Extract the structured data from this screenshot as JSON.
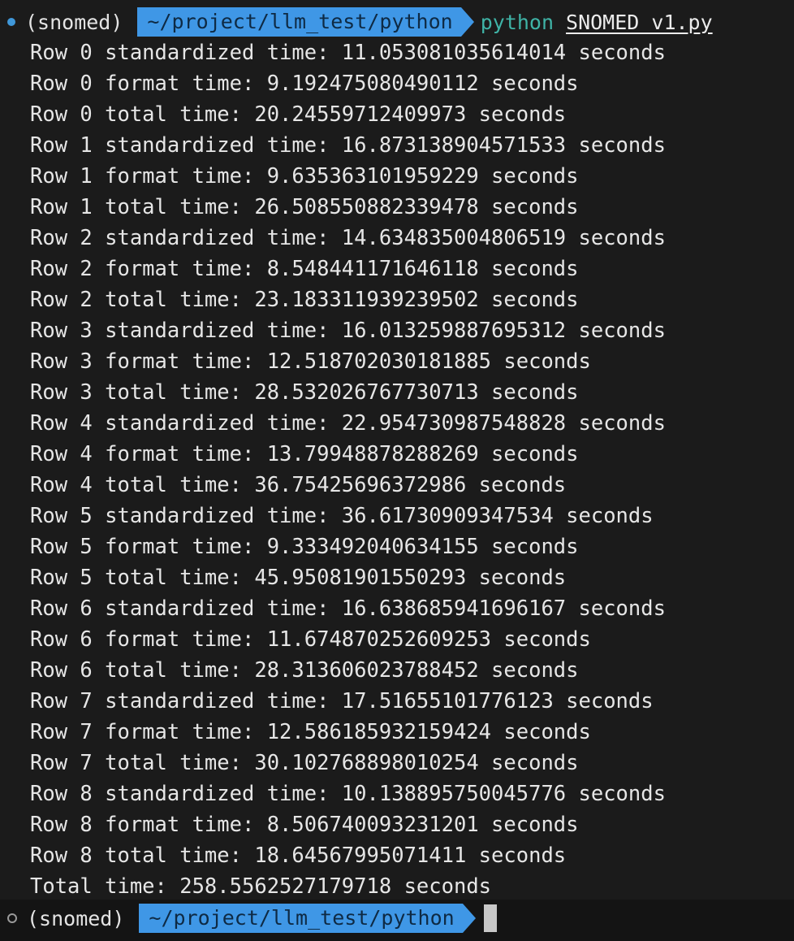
{
  "colors": {
    "background": "#1b1b1b",
    "path_segment": "#3f97e6",
    "command_green": "#3fb3a6",
    "status_dot_active": "#3f97d9"
  },
  "prompt_top": {
    "status_icon": "filled-circle-icon",
    "env": "(snomed)",
    "path": "~/project/llm_test/python",
    "command": "python",
    "script": "SNOMED_v1.py"
  },
  "output": [
    "Row 0 standardized time: 11.053081035614014 seconds",
    "Row 0 format time: 9.192475080490112 seconds",
    "Row 0 total time: 20.24559712409973 seconds",
    "Row 1 standardized time: 16.873138904571533 seconds",
    "Row 1 format time: 9.635363101959229 seconds",
    "Row 1 total time: 26.508550882339478 seconds",
    "Row 2 standardized time: 14.634835004806519 seconds",
    "Row 2 format time: 8.548441171646118 seconds",
    "Row 2 total time: 23.183311939239502 seconds",
    "Row 3 standardized time: 16.013259887695312 seconds",
    "Row 3 format time: 12.518702030181885 seconds",
    "Row 3 total time: 28.532026767730713 seconds",
    "Row 4 standardized time: 22.954730987548828 seconds",
    "Row 4 format time: 13.79948878288269 seconds",
    "Row 4 total time: 36.75425696372986 seconds",
    "Row 5 standardized time: 36.61730909347534 seconds",
    "Row 5 format time: 9.333492040634155 seconds",
    "Row 5 total time: 45.95081901550293 seconds",
    "Row 6 standardized time: 16.638685941696167 seconds",
    "Row 6 format time: 11.674870252609253 seconds",
    "Row 6 total time: 28.313606023788452 seconds",
    "Row 7 standardized time: 17.51655101776123 seconds",
    "Row 7 format time: 12.586185932159424 seconds",
    "Row 7 total time: 30.102768898010254 seconds",
    "Row 8 standardized time: 10.138895750045776 seconds",
    "Row 8 format time: 8.506740093231201 seconds",
    "Row 8 total time: 18.64567995071411 seconds",
    "Total time: 258.5562527179718 seconds"
  ],
  "prompt_bottom": {
    "status_icon": "hollow-circle-icon",
    "env": "(snomed)",
    "path": "~/project/llm_test/python"
  }
}
